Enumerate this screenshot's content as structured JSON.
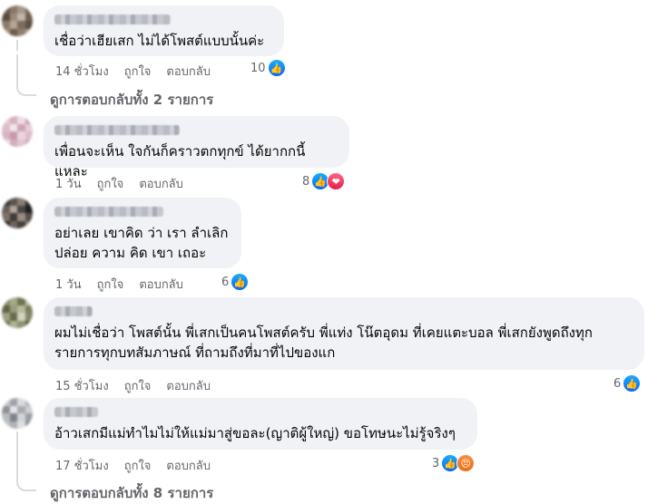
{
  "comments": [
    {
      "text": "เชื่อว่าเฮียเสก ไม่ได้โพสต์แบบนั้นค่ะ",
      "time": "14 ชั่วโมง",
      "like_label": "ถูกใจ",
      "reply_label": "ตอบกลับ",
      "reaction_count": "10",
      "reactions": [
        "like-icon"
      ]
    },
    {
      "text": "เพื่อนจะเห็น ใจกันก็คราวตกทุกข์ ได้ยากกนี้แหละ",
      "time": "1 วัน",
      "like_label": "ถูกใจ",
      "reply_label": "ตอบกลับ",
      "reaction_count": "8",
      "reactions": [
        "like-icon",
        "love-icon"
      ]
    },
    {
      "text": "อย่าเลย เขาคิด ว่า เรา ลำเลิก\nปล่อย ความ คิด เขา เถอะ",
      "time": "1 วัน",
      "like_label": "ถูกใจ",
      "reply_label": "ตอบกลับ",
      "reaction_count": "6",
      "reactions": [
        "like-icon"
      ]
    },
    {
      "text": "ผมไม่เชื่อว่า โพสต์นั้น พี่เสกเป็นคนโพสต์ครับ พี่แท่ง โน๊ตอุดม ที่เคยแตะบอล พี่เสกยังพูดถึงทุก\nรายการทุกบทสัมภาษณ์ ที่ถามถึงที่มาที่ไปของแก",
      "time": "15 ชั่วโมง",
      "like_label": "ถูกใจ",
      "reply_label": "ตอบกลับ",
      "reaction_count": "6",
      "reactions": [
        "like-icon"
      ]
    },
    {
      "text": "อ้าวเสกมีแม่ทำไมไม่ให้แม่มาสู่ขอละ(ญาติผู้ใหญ่) ขอโทษนะไม่รู้จริงๆ",
      "time": "17 ชั่วโมง",
      "like_label": "ถูกใจ",
      "reply_label": "ตอบกลับ",
      "reaction_count": "3",
      "reactions": [
        "like-icon",
        "angry-icon"
      ]
    }
  ],
  "view_replies": [
    "ดูการตอบกลับทั้ง 2 รายการ",
    "ดูการตอบกลับทั้ง 8 รายการ"
  ],
  "colors": {
    "bubble": "#f0f2f5",
    "meta": "#65676b",
    "like": "#0866ff",
    "love": "#f33e58",
    "angry": "#e9710f"
  }
}
